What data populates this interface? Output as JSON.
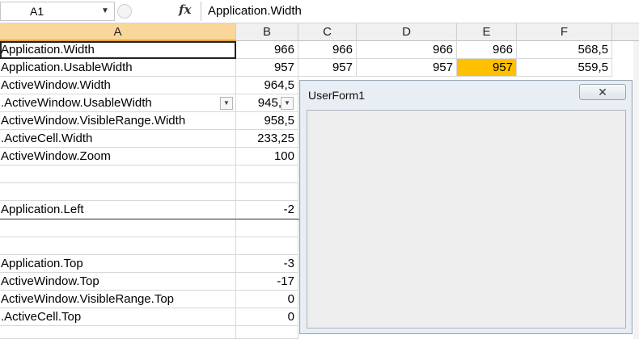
{
  "formula_bar": {
    "name_box": "A1",
    "formula": "Application.Width",
    "fx_label": "fx"
  },
  "columns": [
    {
      "label": "A",
      "selected": true
    },
    {
      "label": "B",
      "selected": false
    },
    {
      "label": "C",
      "selected": false
    },
    {
      "label": "D",
      "selected": false
    },
    {
      "label": "E",
      "selected": false
    },
    {
      "label": "F",
      "selected": false
    }
  ],
  "rows": [
    {
      "a": "Application.Width",
      "b": "966",
      "c": "966",
      "d": "966",
      "e": "966",
      "f": "568,5"
    },
    {
      "a": "Application.UsableWidth",
      "b": "957",
      "c": "957",
      "d": "957",
      "e": "957",
      "f": "559,5"
    },
    {
      "a": "ActiveWindow.Width",
      "b": "964,5"
    },
    {
      "a": ".ActiveWindow.UsableWidth",
      "b": "945,"
    },
    {
      "a": "ActiveWindow.VisibleRange.Width",
      "b": "958,5"
    },
    {
      "a": ".ActiveCell.Width",
      "b": "233,25"
    },
    {
      "a": "ActiveWindow.Zoom",
      "b": "100"
    },
    {
      "a": "",
      "b": ""
    },
    {
      "a": "",
      "b": ""
    },
    {
      "a": "Application.Left",
      "b": "-2"
    },
    {
      "a": "",
      "b": ""
    },
    {
      "a": "",
      "b": ""
    },
    {
      "a": "Application.Top",
      "b": "-3"
    },
    {
      "a": "ActiveWindow.Top",
      "b": "-17"
    },
    {
      "a": "ActiveWindow.VisibleRange.Top",
      "b": "0"
    },
    {
      "a": ".ActiveCell.Top",
      "b": "0"
    }
  ],
  "highlight_color": "#ffc000",
  "userform": {
    "title": "UserForm1",
    "close_glyph": "✕"
  }
}
